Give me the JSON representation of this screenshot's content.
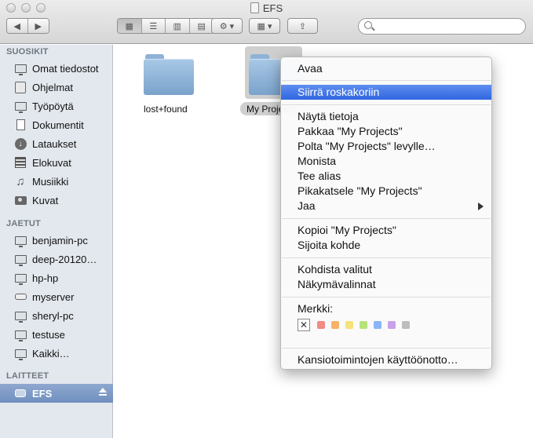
{
  "window": {
    "title": "EFS"
  },
  "toolbar": {
    "back_icon": "◀",
    "forward_icon": "▶",
    "view_icons": [
      "▦",
      "☰",
      "▥",
      "▤"
    ],
    "action_icon": "⚙",
    "arrange_icon": "▦",
    "share_icon": "⇪",
    "search": {
      "value": "",
      "placeholder": ""
    }
  },
  "sidebar": {
    "sections": [
      {
        "header": "SUOSIKIT",
        "items": [
          {
            "label": "Omat tiedostot",
            "icon": "monitor-icon"
          },
          {
            "label": "Ohjelmat",
            "icon": "applications-icon"
          },
          {
            "label": "Työpöytä",
            "icon": "desktop-icon"
          },
          {
            "label": "Dokumentit",
            "icon": "documents-icon"
          },
          {
            "label": "Lataukset",
            "icon": "downloads-icon"
          },
          {
            "label": "Elokuvat",
            "icon": "movies-icon"
          },
          {
            "label": "Musiikki",
            "icon": "music-icon"
          },
          {
            "label": "Kuvat",
            "icon": "camera-icon"
          }
        ]
      },
      {
        "header": "JAETUT",
        "items": [
          {
            "label": "benjamin-pc",
            "icon": "monitor-icon"
          },
          {
            "label": "deep-20120…",
            "icon": "monitor-icon"
          },
          {
            "label": "hp-hp",
            "icon": "monitor-icon"
          },
          {
            "label": "myserver",
            "icon": "server-icon"
          },
          {
            "label": "sheryl-pc",
            "icon": "monitor-icon"
          },
          {
            "label": "testuse",
            "icon": "monitor-icon"
          },
          {
            "label": "Kaikki…",
            "icon": "globe-icon"
          }
        ]
      },
      {
        "header": "LAITTEET",
        "items": [
          {
            "label": "EFS",
            "icon": "disk-icon",
            "selected": true
          }
        ]
      }
    ]
  },
  "main": {
    "folders": [
      {
        "label": "lost+found"
      },
      {
        "label": "My Projects"
      }
    ]
  },
  "context_menu": {
    "open": "Avaa",
    "move_to_trash": "Siirrä roskakoriin",
    "get_info": "Näytä tietoja",
    "compress": "Pakkaa \"My Projects\"",
    "burn": "Polta \"My Projects\" levylle…",
    "duplicate": "Monista",
    "make_alias": "Tee alias",
    "quick_look": "Pikakatsele \"My Projects\"",
    "share": "Jaa",
    "copy": "Kopioi \"My Projects\"",
    "paste": "Sijoita kohde",
    "clean_up": "Kohdista valitut",
    "view_options": "Näkymävalinnat",
    "label_header": "Merkki:",
    "label_none": "✕",
    "label_colors": [
      "#f28b82",
      "#f7b267",
      "#f6e27a",
      "#b7e27a",
      "#8ab4f8",
      "#c8a2e8",
      "#bdbdbd"
    ],
    "services": "Kansiotoimintojen käyttöönotto…"
  },
  "colors": {
    "highlight": "#2f66e0",
    "sidebar_bg": "#e3e8ee",
    "selection": "#6f8fbf"
  }
}
